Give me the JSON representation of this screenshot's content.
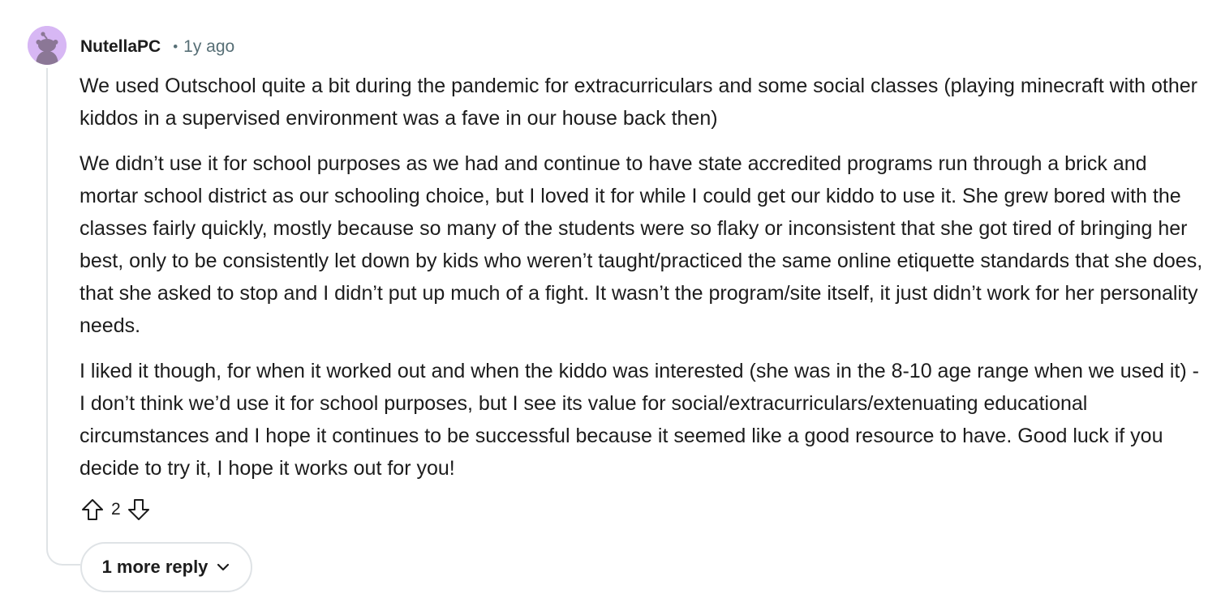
{
  "comment": {
    "author": "NutellaPC",
    "separator": "•",
    "timestamp": "1y ago",
    "avatar_icon": "snoo-avatar-icon",
    "avatar_color": "#d7b7f4",
    "paragraphs": [
      "We used Outschool quite a bit during the pandemic for extracurriculars and some social classes (playing minecraft with other kiddos in a supervised environment was a fave in our house back then)",
      "We didn’t use it for school purposes as we had and continue to have state accredited programs run through a brick and mortar school district as our schooling choice, but I loved it for while I could get our kiddo to use it. She grew bored with the classes fairly quickly, mostly because so many of the students were so flaky or inconsistent that she got tired of bringing her best, only to be consistently let down by kids who weren’t taught/practiced the same online etiquette standards that she does, that she asked to stop and I didn’t put up much of a fight. It wasn’t the program/site itself, it just didn’t work for her personality needs.",
      "I liked it though, for when it worked out and when the kiddo was interested (she was in the 8-10 age range when we used it) - I don’t think we’d use it for school purposes, but I see its value for social/extracurriculars/extenuating educational circumstances and I hope it continues to be successful because it seemed like a good resource to have. Good luck if you decide to try it, I hope it works out for you!"
    ],
    "score": "2",
    "upvote_icon": "upvote-arrow-icon",
    "downvote_icon": "downvote-arrow-icon"
  },
  "replies": {
    "more_label": "1 more reply",
    "chevron_icon": "chevron-down-icon"
  },
  "colors": {
    "text": "#1c1c1c",
    "meta_text": "#576f76",
    "thread_line": "#dfe3e6"
  }
}
